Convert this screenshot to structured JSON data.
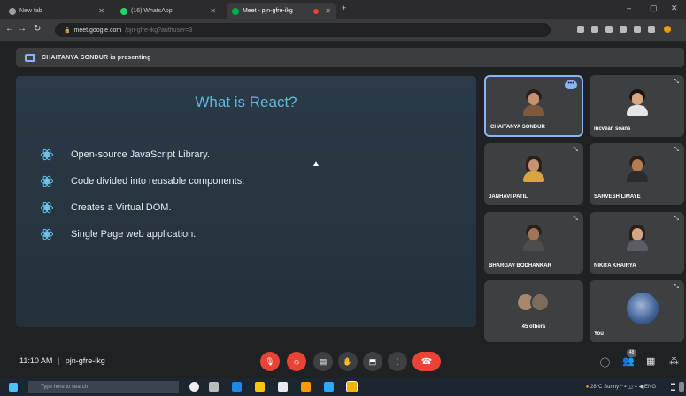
{
  "browser": {
    "tabs": [
      {
        "label": "New tab"
      },
      {
        "label": "(16) WhatsApp"
      },
      {
        "label": "Meet - pjn-gfre-ikg"
      }
    ],
    "url": "meet.google.com",
    "url_rest": "/pjn-gfre-ikg?authuser=3"
  },
  "presenting": {
    "text": "CHAITANYA SONDUR is presenting"
  },
  "slide": {
    "title": "What is React?",
    "bullets": [
      "Open-source JavaScript Library.",
      "Code divided into reusable components.",
      "Creates a Virtual DOM.",
      "Single Page web application."
    ]
  },
  "participants": [
    {
      "name": "CHAITANYA SONDUR",
      "more": "•••"
    },
    {
      "name": "incvean soans"
    },
    {
      "name": "JANHAVI PATIL"
    },
    {
      "name": "SARVESH LIMAYE"
    },
    {
      "name": "BHARGAV BODHANKAR"
    },
    {
      "name": "NIKITA KHAIRYA"
    },
    {
      "name": "45 others"
    },
    {
      "name": "You"
    }
  ],
  "meeting": {
    "time": "11:10 AM",
    "separator": "|",
    "code": "pjn-gfre-ikg",
    "people_count": "48"
  },
  "taskbar": {
    "search_placeholder": "Type here to search",
    "weather": "28°C Sunny",
    "lang": "ENG"
  },
  "colors": {
    "accent": "#8ab4f8",
    "danger": "#ea4335",
    "slide_title": "#5fb8df"
  }
}
